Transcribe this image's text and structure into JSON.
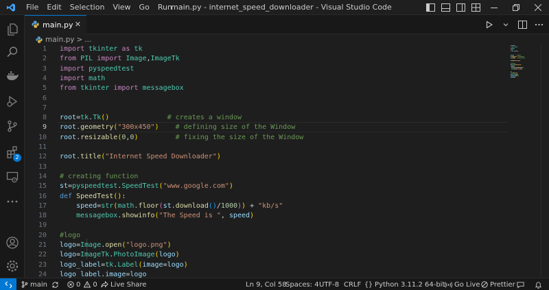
{
  "window": {
    "title": "main.py - internet_speed_downloader - Visual Studio Code",
    "menu": [
      "File",
      "Edit",
      "Selection",
      "View",
      "Go",
      "Run",
      "···"
    ]
  },
  "tab": {
    "label": "main.py",
    "close": "✕"
  },
  "breadcrumb": {
    "file": "main.py",
    "sep": ">",
    "more": "..."
  },
  "activity": {
    "extensions_badge": "2"
  },
  "editor": {
    "active_line": 9,
    "lines": [
      {
        "n": "1",
        "segs": [
          [
            "kw",
            "import"
          ],
          [
            "pl",
            " "
          ],
          [
            "cls",
            "tkinter"
          ],
          [
            "pl",
            " "
          ],
          [
            "kw",
            "as"
          ],
          [
            "pl",
            " "
          ],
          [
            "cls",
            "tk"
          ]
        ]
      },
      {
        "n": "2",
        "segs": [
          [
            "kw",
            "from"
          ],
          [
            "pl",
            " "
          ],
          [
            "cls",
            "PIL"
          ],
          [
            "pl",
            " "
          ],
          [
            "kw",
            "import"
          ],
          [
            "pl",
            " "
          ],
          [
            "cls",
            "Image"
          ],
          [
            "pl",
            ","
          ],
          [
            "cls",
            "ImageTk"
          ]
        ]
      },
      {
        "n": "3",
        "segs": [
          [
            "kw",
            "import"
          ],
          [
            "pl",
            " "
          ],
          [
            "cls",
            "pyspeedtest"
          ]
        ]
      },
      {
        "n": "4",
        "segs": [
          [
            "kw",
            "import"
          ],
          [
            "pl",
            " "
          ],
          [
            "cls",
            "math"
          ]
        ]
      },
      {
        "n": "5",
        "segs": [
          [
            "kw",
            "from"
          ],
          [
            "pl",
            " "
          ],
          [
            "cls",
            "tkinter"
          ],
          [
            "pl",
            " "
          ],
          [
            "kw",
            "import"
          ],
          [
            "pl",
            " "
          ],
          [
            "cls",
            "messagebox"
          ]
        ]
      },
      {
        "n": "6",
        "segs": []
      },
      {
        "n": "7",
        "segs": []
      },
      {
        "n": "8",
        "segs": [
          [
            "var",
            "root"
          ],
          [
            "pl",
            "="
          ],
          [
            "cls",
            "tk"
          ],
          [
            "pl",
            "."
          ],
          [
            "cls",
            "Tk"
          ],
          [
            "br1",
            "()"
          ],
          [
            "pl",
            "              "
          ],
          [
            "cm",
            "# creates a window"
          ]
        ]
      },
      {
        "n": "9",
        "segs": [
          [
            "var",
            "root"
          ],
          [
            "pl",
            "."
          ],
          [
            "fn",
            "geometry"
          ],
          [
            "br1",
            "("
          ],
          [
            "str",
            "\"300x450\""
          ],
          [
            "br1",
            ")"
          ],
          [
            "pl",
            "    "
          ],
          [
            "cm",
            "# defining size of the Window"
          ]
        ]
      },
      {
        "n": "10",
        "segs": [
          [
            "var",
            "root"
          ],
          [
            "pl",
            "."
          ],
          [
            "fn",
            "resizable"
          ],
          [
            "br1",
            "("
          ],
          [
            "num",
            "0"
          ],
          [
            "pl",
            ","
          ],
          [
            "num",
            "0"
          ],
          [
            "br1",
            ")"
          ],
          [
            "pl",
            "         "
          ],
          [
            "cm",
            "# fixing the size of the Window"
          ]
        ]
      },
      {
        "n": "11",
        "segs": []
      },
      {
        "n": "12",
        "segs": [
          [
            "var",
            "root"
          ],
          [
            "pl",
            "."
          ],
          [
            "fn",
            "title"
          ],
          [
            "br1",
            "("
          ],
          [
            "str",
            "\"Internet Speed Downloader\""
          ],
          [
            "br1",
            ")"
          ]
        ]
      },
      {
        "n": "13",
        "segs": []
      },
      {
        "n": "14",
        "segs": [
          [
            "cm",
            "# creating function"
          ]
        ]
      },
      {
        "n": "15",
        "segs": [
          [
            "var",
            "st"
          ],
          [
            "pl",
            "="
          ],
          [
            "cls",
            "pyspeedtest"
          ],
          [
            "pl",
            "."
          ],
          [
            "cls",
            "SpeedTest"
          ],
          [
            "br1",
            "("
          ],
          [
            "str",
            "\"www.google.com\""
          ],
          [
            "br1",
            ")"
          ]
        ]
      },
      {
        "n": "16",
        "segs": [
          [
            "kb",
            "def"
          ],
          [
            "pl",
            " "
          ],
          [
            "fn",
            "SpeedTest"
          ],
          [
            "br1",
            "()"
          ],
          [
            "pl",
            ":"
          ]
        ]
      },
      {
        "n": "17",
        "segs": [
          [
            "pl",
            "    "
          ],
          [
            "var",
            "speed"
          ],
          [
            "pl",
            "="
          ],
          [
            "cls",
            "str"
          ],
          [
            "br1",
            "("
          ],
          [
            "cls",
            "math"
          ],
          [
            "pl",
            "."
          ],
          [
            "fn",
            "floor"
          ],
          [
            "br2",
            "("
          ],
          [
            "var",
            "st"
          ],
          [
            "pl",
            "."
          ],
          [
            "fn",
            "download"
          ],
          [
            "br3",
            "()"
          ],
          [
            "pl",
            "/"
          ],
          [
            "num",
            "1000"
          ],
          [
            "br2",
            ")"
          ],
          [
            "br1",
            ")"
          ],
          [
            "pl",
            " + "
          ],
          [
            "str",
            "\"kb/s\""
          ]
        ]
      },
      {
        "n": "18",
        "segs": [
          [
            "pl",
            "    "
          ],
          [
            "cls",
            "messagebox"
          ],
          [
            "pl",
            "."
          ],
          [
            "fn",
            "showinfo"
          ],
          [
            "br1",
            "("
          ],
          [
            "str",
            "\"The Speed is \""
          ],
          [
            "pl",
            ", "
          ],
          [
            "var",
            "speed"
          ],
          [
            "br1",
            ")"
          ]
        ]
      },
      {
        "n": "19",
        "segs": []
      },
      {
        "n": "20",
        "segs": [
          [
            "cm",
            "#logo"
          ]
        ]
      },
      {
        "n": "21",
        "segs": [
          [
            "var",
            "logo"
          ],
          [
            "pl",
            "="
          ],
          [
            "cls",
            "Image"
          ],
          [
            "pl",
            "."
          ],
          [
            "fn",
            "open"
          ],
          [
            "br1",
            "("
          ],
          [
            "str",
            "\"logo.png\""
          ],
          [
            "br1",
            ")"
          ]
        ]
      },
      {
        "n": "22",
        "segs": [
          [
            "var",
            "logo"
          ],
          [
            "pl",
            "="
          ],
          [
            "cls",
            "ImageTk"
          ],
          [
            "pl",
            "."
          ],
          [
            "cls",
            "PhotoImage"
          ],
          [
            "br1",
            "("
          ],
          [
            "var",
            "logo"
          ],
          [
            "br1",
            ")"
          ]
        ]
      },
      {
        "n": "23",
        "segs": [
          [
            "var",
            "logo_label"
          ],
          [
            "pl",
            "="
          ],
          [
            "cls",
            "tk"
          ],
          [
            "pl",
            "."
          ],
          [
            "cls",
            "Label"
          ],
          [
            "br1",
            "("
          ],
          [
            "var",
            "image"
          ],
          [
            "pl",
            "="
          ],
          [
            "var",
            "logo"
          ],
          [
            "br1",
            ")"
          ]
        ]
      },
      {
        "n": "24",
        "segs": [
          [
            "var",
            "logo_label"
          ],
          [
            "pl",
            "."
          ],
          [
            "var",
            "image"
          ],
          [
            "pl",
            "="
          ],
          [
            "var",
            "logo"
          ]
        ]
      }
    ]
  },
  "statusbar": {
    "branch": "main",
    "errors": "0",
    "warnings": "0",
    "live_share": "Live Share",
    "position": "Ln 9, Col 58",
    "spaces": "Spaces: 4",
    "encoding": "UTF-8",
    "eol": "CRLF",
    "language": "Python",
    "interpreter": "3.11.2 64-bit",
    "go_live": "Go Live",
    "prettier": "Prettier"
  },
  "colors": {
    "accent": "#0078d4",
    "keyword": "#c586c0",
    "function": "#dcdcaa",
    "class": "#4ec9b0",
    "string": "#ce9178",
    "number": "#b5cea8",
    "comment": "#6a9955",
    "variable": "#9cdcfe"
  }
}
